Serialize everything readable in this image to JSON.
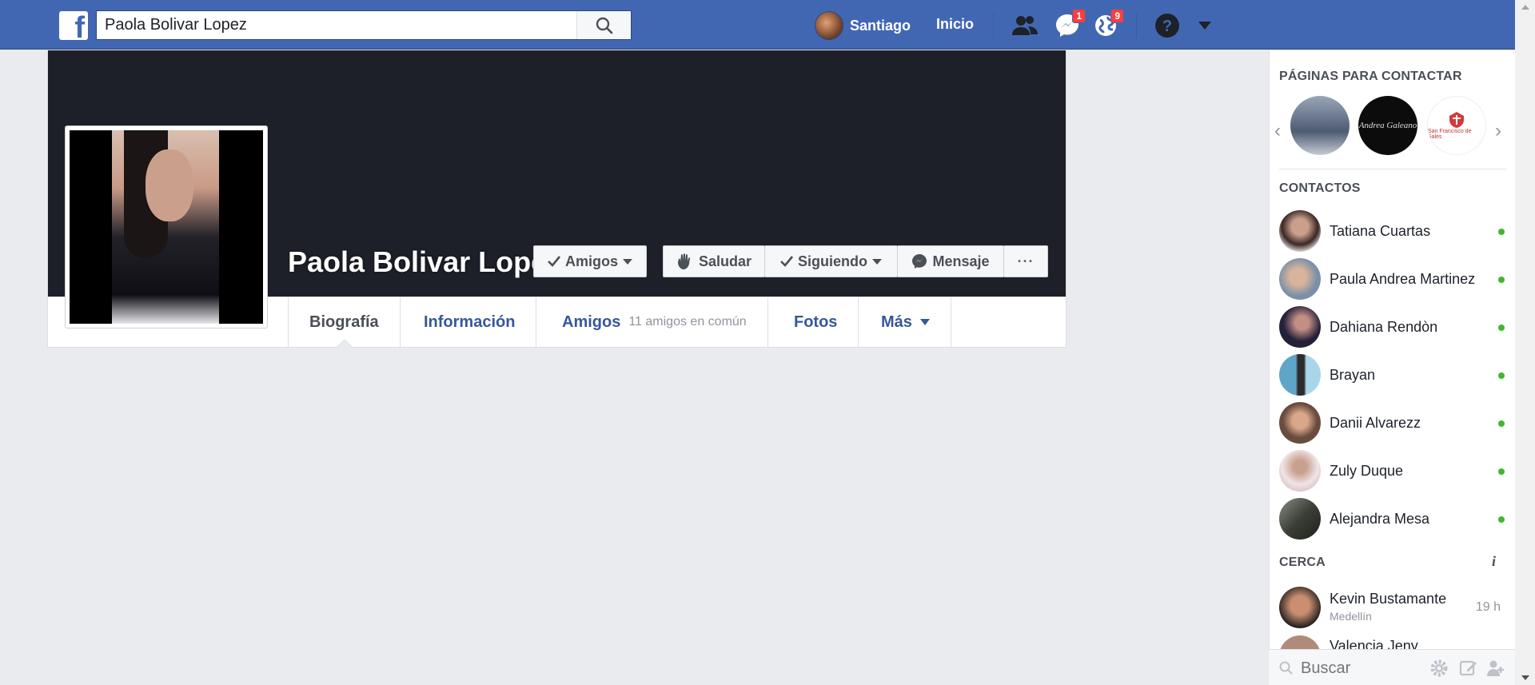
{
  "topbar": {
    "search_value": "Paola Bolivar Lopez",
    "user_name": "Santiago",
    "home_label": "Inicio",
    "messages_badge": "1",
    "notifications_badge": "9",
    "brand_color": "#4267b2"
  },
  "profile": {
    "name": "Paola Bolivar Lopez",
    "buttons": {
      "friends": "Amigos",
      "greet": "Saludar",
      "following": "Siguiendo",
      "message": "Mensaje",
      "more": "···"
    },
    "tabs": {
      "timeline": "Biografía",
      "about": "Información",
      "friends": "Amigos",
      "friends_sub": "11 amigos en común",
      "photos": "Fotos",
      "more": "Más"
    }
  },
  "sidebar": {
    "pages_heading": "PÁGINAS PARA CONTACTAR",
    "pages": [
      {
        "label": ""
      },
      {
        "label": "Andrea Galeano"
      },
      {
        "label": "San Francisco de Sales"
      }
    ],
    "contacts_heading": "CONTACTOS",
    "contacts": [
      {
        "name": "Tatiana Cuartas",
        "color": "#5a3b35"
      },
      {
        "name": "Paula Andrea Martinez",
        "color": "#7a8fa8"
      },
      {
        "name": "Dahiana Rendòn",
        "color": "#23213a"
      },
      {
        "name": "Brayan",
        "color": "#5fa5c9"
      },
      {
        "name": "Danii Alvarezz",
        "color": "#6a4c3f"
      },
      {
        "name": "Zuly Duque",
        "color": "#d6c2c4"
      },
      {
        "name": "Alejandra Mesa",
        "color": "#3c3f37"
      }
    ],
    "nearby_heading": "CERCA",
    "nearby": [
      {
        "name": "Kevin Bustamante",
        "location": "Medellín",
        "time": "19 h"
      },
      {
        "name": "Valencia Jeny"
      }
    ],
    "chat_search_placeholder": "Buscar"
  }
}
